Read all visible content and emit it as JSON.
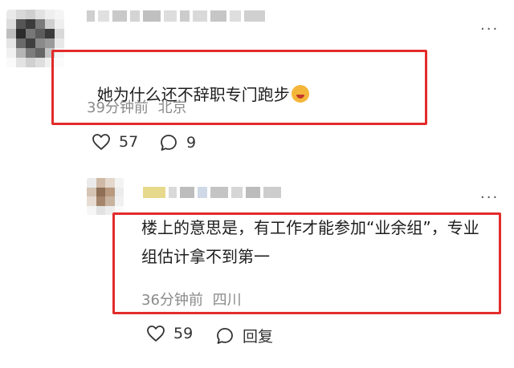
{
  "comments": [
    {
      "text": "她为什么还不辞职专门跑步",
      "emoji": "laughing-face-emoji",
      "time": "39分钟前",
      "location": "北京",
      "likes": "57",
      "replies": "9"
    },
    {
      "text": "楼上的意思是，有工作才能参加“业余组”，专业组估计拿不到第一",
      "time": "36分钟前",
      "location": "四川",
      "likes": "59",
      "reply_label": "回复"
    }
  ],
  "icons": {
    "more": "more-options-icon",
    "like": "heart-icon",
    "comment": "comment-bubble-icon"
  },
  "colors": {
    "highlight_box": "#e32b2b",
    "meta_text": "#8a8a8a"
  }
}
